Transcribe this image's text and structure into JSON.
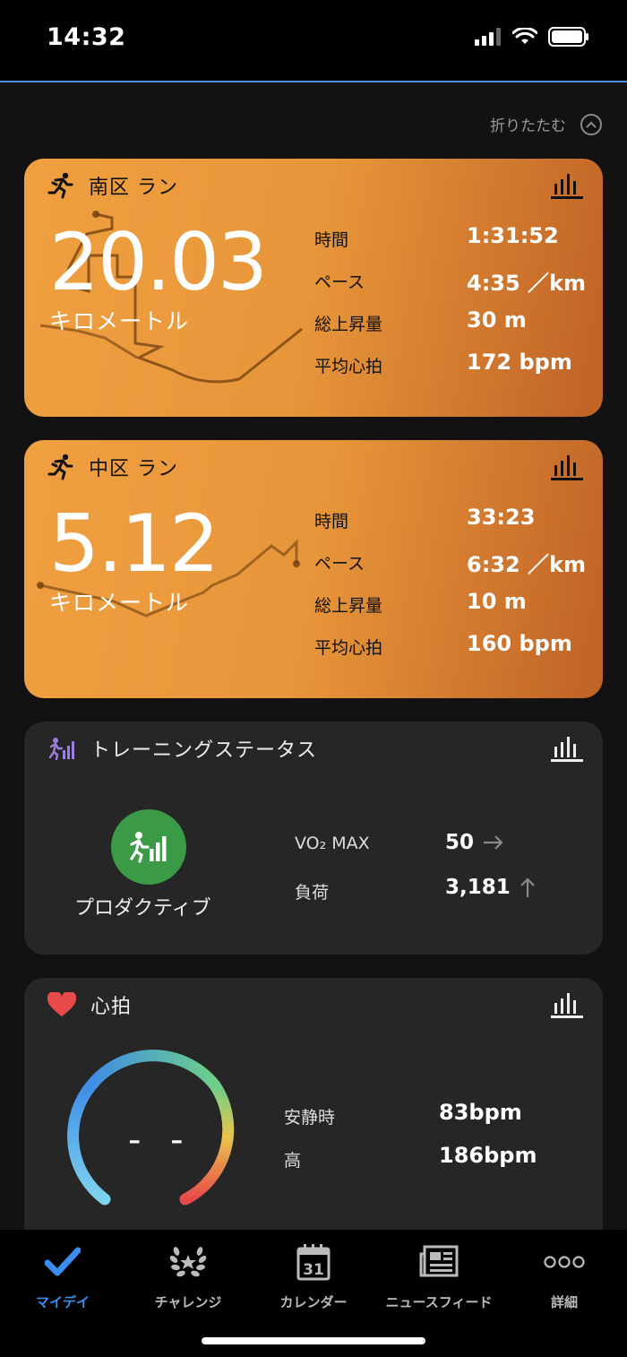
{
  "status_bar": {
    "time": "14:32"
  },
  "header": {
    "collapse_label": "折りたたむ"
  },
  "activities": [
    {
      "title": "南区 ラン",
      "distance": "20.03",
      "unit": "キロメートル",
      "stats": [
        {
          "label": "時間",
          "value": "1:31:52"
        },
        {
          "label": "ペース",
          "value": "4:35 ／km"
        },
        {
          "label": "総上昇量",
          "value": "30 m"
        },
        {
          "label": "平均心拍",
          "value": "172 bpm"
        }
      ]
    },
    {
      "title": "中区 ラン",
      "distance": "5.12",
      "unit": "キロメートル",
      "stats": [
        {
          "label": "時間",
          "value": "33:23"
        },
        {
          "label": "ペース",
          "value": "6:32 ／km"
        },
        {
          "label": "総上昇量",
          "value": "10 m"
        },
        {
          "label": "平均心拍",
          "value": "160 bpm"
        }
      ]
    }
  ],
  "training_status": {
    "title": "トレーニングステータス",
    "status": "プロダクティブ",
    "vo2_label": "VO₂ MAX",
    "vo2_value": "50",
    "load_label": "負荷",
    "load_value": "3,181"
  },
  "heart_rate": {
    "title": "心拍",
    "current": "- -",
    "resting_label": "安静時",
    "resting_value": "83bpm",
    "high_label": "高",
    "high_value": "186bpm"
  },
  "tabs": [
    {
      "label": "マイデイ",
      "icon": "check-icon",
      "active": true
    },
    {
      "label": "チャレンジ",
      "icon": "laurel-icon",
      "active": false
    },
    {
      "label": "カレンダー",
      "icon": "calendar-icon",
      "calendar_day": "31",
      "active": false
    },
    {
      "label": "ニュースフィード",
      "icon": "newsfeed-icon",
      "active": false
    },
    {
      "label": "詳細",
      "icon": "more-dots-icon",
      "active": false
    }
  ],
  "colors": {
    "accent_blue": "#3a8ef0",
    "card_orange": "#e7953a",
    "productive_green": "#3a9a46",
    "heart_red": "#e84a4a"
  }
}
